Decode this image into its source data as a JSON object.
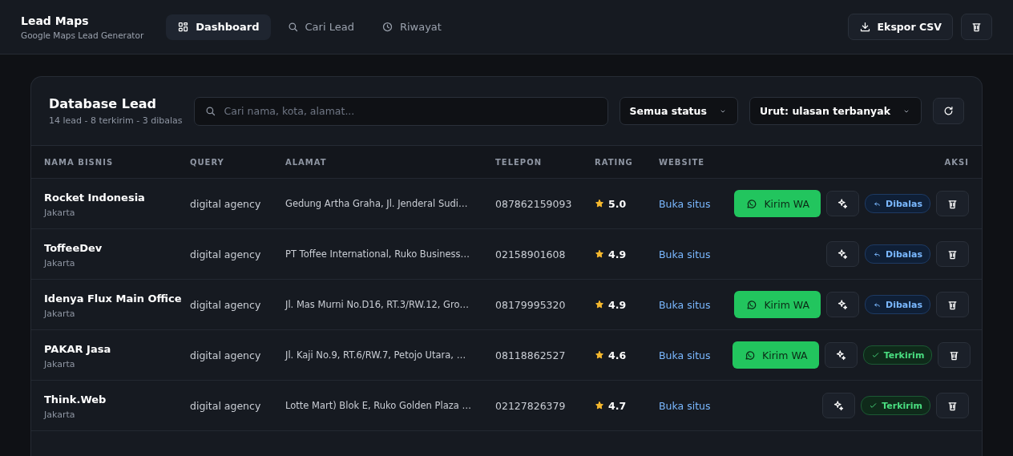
{
  "app": {
    "title": "Lead Maps",
    "subtitle": "Google Maps Lead Generator"
  },
  "nav": [
    {
      "label": "Dashboard",
      "selected": true
    },
    {
      "label": "Cari Lead",
      "selected": false
    },
    {
      "label": "Riwayat",
      "selected": false
    }
  ],
  "header_actions": {
    "export_label": "Ekspor CSV"
  },
  "panel": {
    "title": "Database Lead",
    "summary": "14 lead - 8 terkirim - 3 dibalas",
    "search": {
      "placeholder": "Cari nama, kota, alamat..."
    },
    "status_filter": "Semua status",
    "sort": "Urut: ulasan terbanyak"
  },
  "table": {
    "columns": [
      "NAMA BISNIS",
      "QUERY",
      "ALAMAT",
      "TELEPON",
      "RATING",
      "WEBSITE",
      "AKSI"
    ],
    "rows": [
      {
        "name": "Rocket Indonesia",
        "city": "Jakarta",
        "query": "digital agency",
        "address": "Gedung Artha Graha, Jl. Jenderal Sudi…",
        "phone": "087862159093",
        "rating": "5.0",
        "website": "Buka situs",
        "wa_button": "Kirim WA",
        "status": {
          "kind": "replied",
          "label": "Dibalas"
        }
      },
      {
        "name": "ToffeeDev",
        "city": "Jakarta",
        "query": "digital agency",
        "address": "PT Toffee International, Ruko Business…",
        "phone": "02158901608",
        "rating": "4.9",
        "website": "Buka situs",
        "status": {
          "kind": "replied",
          "label": "Dibalas"
        }
      },
      {
        "name": "Idenya Flux Main Office",
        "city": "Jakarta",
        "query": "digital agency",
        "address": "Jl. Mas Murni No.D16, RT.3/RW.12, Gro…",
        "phone": "08179995320",
        "rating": "4.9",
        "website": "Buka situs",
        "wa_button": "Kirim WA",
        "status": {
          "kind": "replied",
          "label": "Dibalas"
        }
      },
      {
        "name": "PAKAR Jasa",
        "city": "Jakarta",
        "query": "digital agency",
        "address": "Jl. Kaji No.9, RT.6/RW.7, Petojo Utara, …",
        "phone": "08118862527",
        "rating": "4.6",
        "website": "Buka situs",
        "wa_button": "Kirim WA",
        "status": {
          "kind": "sent",
          "label": "Terkirim"
        }
      },
      {
        "name": "Think.Web",
        "city": "Jakarta",
        "query": "digital agency",
        "address": "Lotte Mart) Blok E, Ruko Golden Plaza …",
        "phone": "02127826379",
        "rating": "4.7",
        "website": "Buka situs",
        "status": {
          "kind": "sent",
          "label": "Terkirim"
        }
      }
    ]
  }
}
